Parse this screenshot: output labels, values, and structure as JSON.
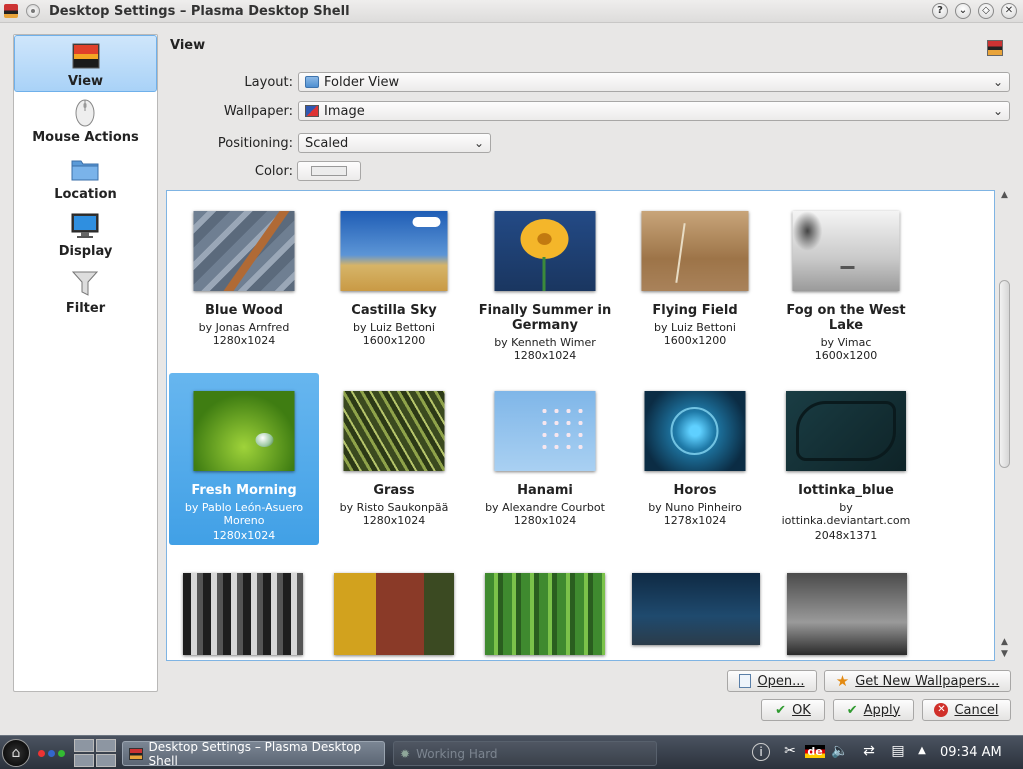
{
  "window": {
    "title": "Desktop Settings – Plasma Desktop Shell",
    "buttons": [
      "?",
      "⌄",
      "◇",
      "✕"
    ]
  },
  "sidebar": {
    "items": [
      {
        "label": "View",
        "selected": true
      },
      {
        "label": "Mouse Actions"
      },
      {
        "label": "Location"
      },
      {
        "label": "Display"
      },
      {
        "label": "Filter"
      }
    ]
  },
  "view": {
    "title": "View",
    "layout_label": "Layout:",
    "layout_value": "Folder View",
    "wallpaper_label": "Wallpaper:",
    "wallpaper_value": "Image",
    "positioning_label": "Positioning:",
    "positioning_value": "Scaled",
    "color_label": "Color:"
  },
  "wallpapers": [
    {
      "name": "Blue Wood",
      "author": "by Jonas Arnfred",
      "size": "1280x1024"
    },
    {
      "name": "Castilla Sky",
      "author": "by Luiz Bettoni",
      "size": "1600x1200"
    },
    {
      "name": "Finally Summer in Germany",
      "author": "by Kenneth Wimer",
      "size": "1280x1024"
    },
    {
      "name": "Flying Field",
      "author": "by Luiz Bettoni",
      "size": "1600x1200"
    },
    {
      "name": "Fog on the West Lake",
      "author": "by Vimac",
      "size": "1600x1200"
    },
    {
      "name": "Fresh Morning",
      "author": "by Pablo León-Asuero Moreno",
      "size": "1280x1024",
      "selected": true
    },
    {
      "name": "Grass",
      "author": "by Risto Saukonpää",
      "size": "1280x1024"
    },
    {
      "name": "Hanami",
      "author": "by Alexandre Courbot",
      "size": "1280x1024"
    },
    {
      "name": "Horos",
      "author": "by Nuno Pinheiro",
      "size": "1278x1024"
    },
    {
      "name": "Iottinka_blue",
      "author": "by iottinka.deviantart.com",
      "size": "2048x1371"
    }
  ],
  "buttons": {
    "open": "Open...",
    "get_new": "Get New Wallpapers...",
    "ok": "OK",
    "apply": "Apply",
    "cancel": "Cancel"
  },
  "taskbar": {
    "active_task": "Desktop Settings – Plasma Desktop Shell",
    "job_task": "Working Hard",
    "keyboard_layout": "de",
    "clock": "09:34 AM"
  },
  "colors": {
    "selection": "#41a0e6",
    "grid_border": "#7fb4e3"
  }
}
